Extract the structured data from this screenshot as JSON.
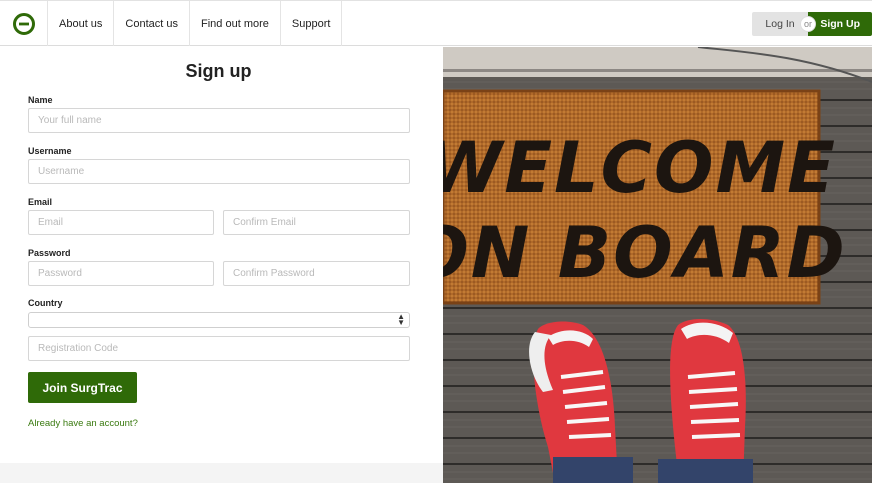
{
  "navbar": {
    "logo_icon": "surgtrac-logo-icon",
    "items": [
      "About us",
      "Contact us",
      "Find out more",
      "Support"
    ],
    "login_label": "Log In",
    "or_label": "or",
    "signup_label": "Sign Up"
  },
  "form": {
    "title": "Sign up",
    "name": {
      "label": "Name",
      "placeholder": "Your full name"
    },
    "username": {
      "label": "Username",
      "placeholder": "Username"
    },
    "email": {
      "label": "Email",
      "placeholder": "Email",
      "confirm_placeholder": "Confirm Email"
    },
    "password": {
      "label": "Password",
      "placeholder": "Password",
      "confirm_placeholder": "Confirm Password"
    },
    "country": {
      "label": "Country",
      "value": ""
    },
    "registration_code": {
      "placeholder": "Registration Code"
    },
    "submit_label": "Join SurgTrac",
    "already_link": "Already have an account?"
  },
  "photo": {
    "mat_text_line1": "WELCOME",
    "mat_text_line2": "ON BOARD"
  },
  "colors": {
    "brand_green": "#2f6a08",
    "link_green": "#3a7a10"
  }
}
